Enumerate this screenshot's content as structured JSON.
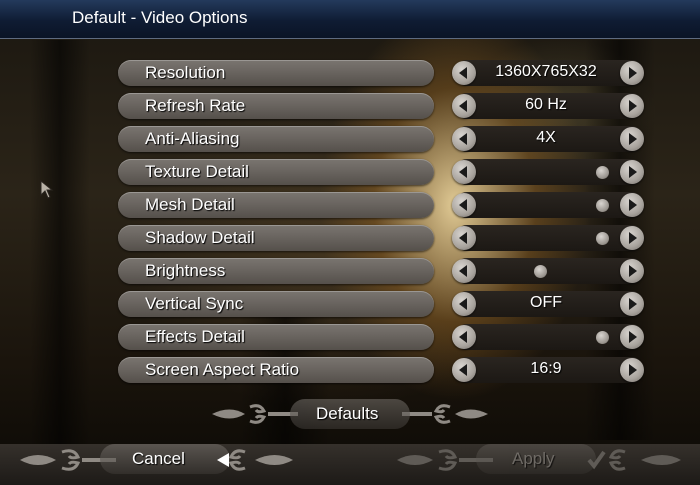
{
  "window": {
    "title": "Default - Video Options"
  },
  "options": [
    {
      "label": "Resolution",
      "value": "1360X765X32",
      "type": "value"
    },
    {
      "label": "Refresh Rate",
      "value": "60 Hz",
      "type": "value"
    },
    {
      "label": "Anti-Aliasing",
      "value": "4X",
      "type": "value"
    },
    {
      "label": "Texture Detail",
      "value": "",
      "type": "slider",
      "level": 1.0
    },
    {
      "label": "Mesh Detail",
      "value": "",
      "type": "slider",
      "level": 1.0
    },
    {
      "label": "Shadow Detail",
      "value": "",
      "type": "slider",
      "level": 1.0
    },
    {
      "label": "Brightness",
      "value": "",
      "type": "slider",
      "level": 0.45
    },
    {
      "label": "Vertical Sync",
      "value": "OFF",
      "type": "value"
    },
    {
      "label": "Effects Detail",
      "value": "",
      "type": "slider",
      "level": 1.0
    },
    {
      "label": "Screen Aspect Ratio",
      "value": "16:9",
      "type": "value"
    }
  ],
  "buttons": {
    "defaults": "Defaults",
    "cancel": "Cancel",
    "apply": "Apply"
  },
  "icons": {
    "arrow_left": "arrow-left-icon",
    "arrow_right": "arrow-right-icon",
    "checkmark": "checkmark-icon",
    "cursor": "cursor-arrow-icon"
  },
  "colors": {
    "title_bar": "#0f1c33",
    "pill": "#6a6560",
    "text": "#ffffff",
    "disabled_text": "#9a9690"
  }
}
